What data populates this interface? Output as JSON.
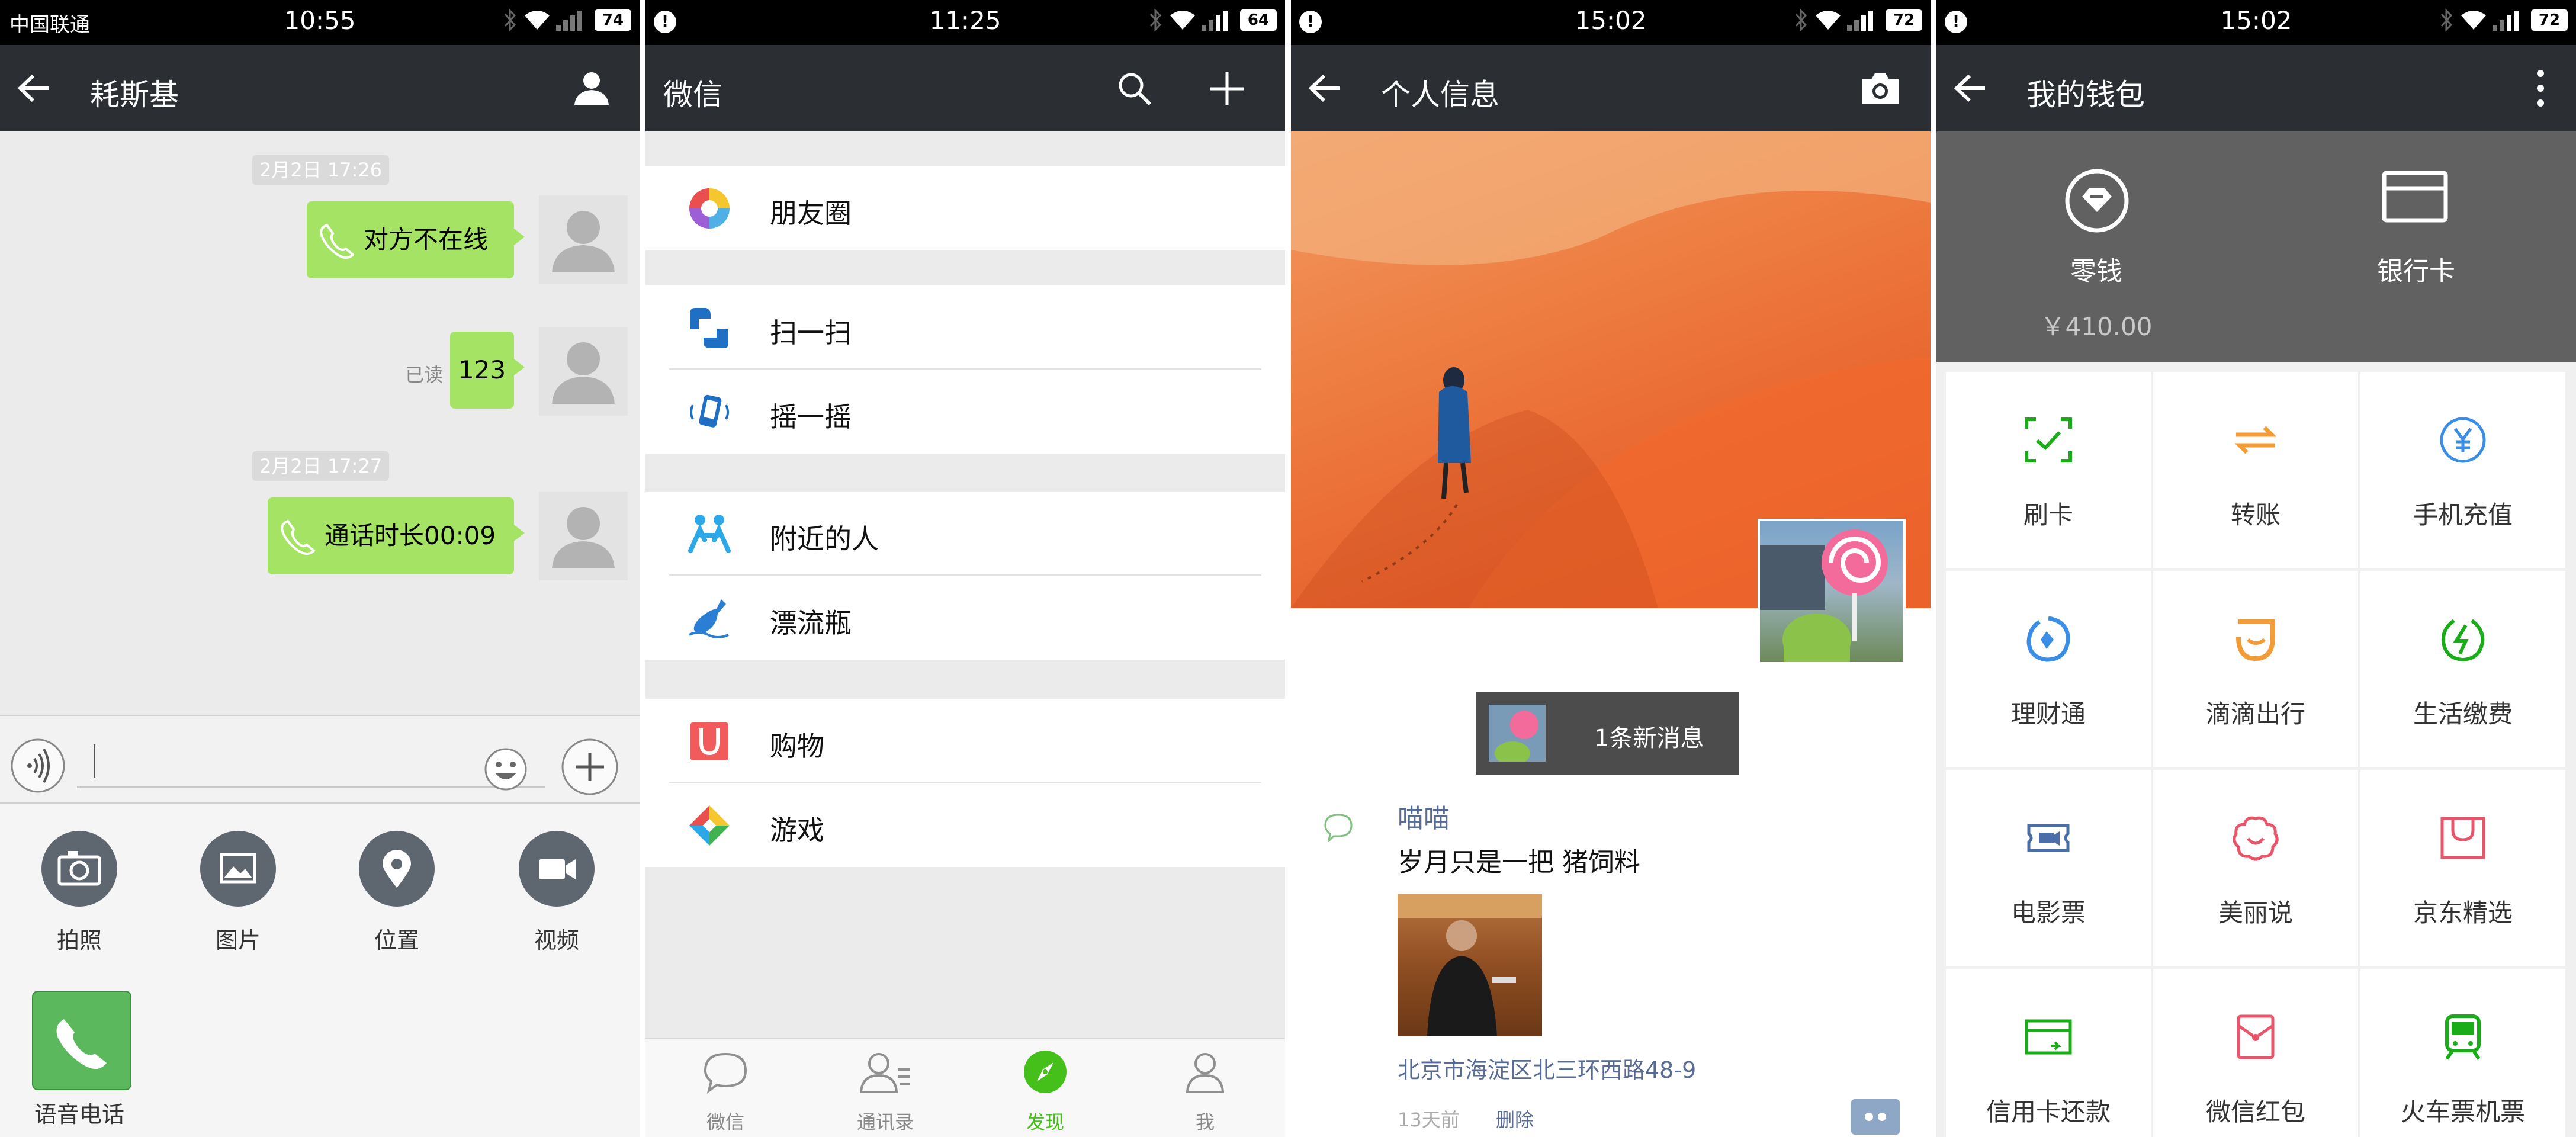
{
  "screen1": {
    "status": {
      "carrier": "中国联通",
      "time": "10:55",
      "battery": "74"
    },
    "title": "耗斯基",
    "messages": [
      {
        "time": "2月2日 17:26"
      },
      {
        "text": "对方不在线"
      },
      {
        "read": "已读",
        "text": "123"
      },
      {
        "time": "2月2日 17:27"
      },
      {
        "text": "通话时长00:09"
      }
    ],
    "panel": [
      {
        "label": "拍照",
        "icon": "camera-icon"
      },
      {
        "label": "图片",
        "icon": "image-icon"
      },
      {
        "label": "位置",
        "icon": "location-icon"
      },
      {
        "label": "视频",
        "icon": "video-icon"
      },
      {
        "label": "语音电话",
        "icon": "phone-icon"
      }
    ]
  },
  "screen2": {
    "status": {
      "time": "11:25",
      "battery": "64"
    },
    "title": "微信",
    "items": [
      {
        "label": "朋友圈",
        "icon": "moments-icon"
      },
      {
        "label": "扫一扫",
        "icon": "scan-icon"
      },
      {
        "label": "摇一摇",
        "icon": "shake-icon"
      },
      {
        "label": "附近的人",
        "icon": "nearby-icon"
      },
      {
        "label": "漂流瓶",
        "icon": "bottle-icon"
      },
      {
        "label": "购物",
        "icon": "shopping-icon"
      },
      {
        "label": "游戏",
        "icon": "games-icon"
      }
    ],
    "tabs": [
      {
        "label": "微信",
        "icon": "chat-icon"
      },
      {
        "label": "通讯录",
        "icon": "contacts-icon"
      },
      {
        "label": "发现",
        "icon": "discover-icon"
      },
      {
        "label": "我",
        "icon": "me-icon"
      }
    ],
    "active_color": "#45c01a"
  },
  "screen3": {
    "status": {
      "time": "15:02",
      "battery": "72"
    },
    "title": "个人信息",
    "new_message": "1条新消息",
    "post": {
      "name": "喵喵",
      "text": "岁月只是一把 猪饲料",
      "location": "北京市海淀区北三环西路48-9",
      "time": "13天前",
      "delete": "删除"
    }
  },
  "screen4": {
    "status": {
      "time": "15:02",
      "battery": "72"
    },
    "title": "我的钱包",
    "header": [
      {
        "label": "零钱",
        "value": "￥410.00",
        "icon": "coin-icon"
      },
      {
        "label": "银行卡",
        "icon": "bank-card-icon"
      }
    ],
    "grid": [
      {
        "label": "刷卡",
        "icon": "pay-card-icon",
        "color": "#1aad19"
      },
      {
        "label": "转账",
        "icon": "transfer-icon",
        "color": "#f29c38"
      },
      {
        "label": "手机充值",
        "icon": "phone-topup-icon",
        "color": "#3a8ee6"
      },
      {
        "label": "理财通",
        "icon": "wealth-icon",
        "color": "#3a8ee6"
      },
      {
        "label": "滴滴出行",
        "icon": "didi-icon",
        "color": "#f29c38"
      },
      {
        "label": "生活缴费",
        "icon": "utility-icon",
        "color": "#1aad19"
      },
      {
        "label": "电影票",
        "icon": "movie-ticket-icon",
        "color": "#4a6fa8"
      },
      {
        "label": "美丽说",
        "icon": "meilishuo-icon",
        "color": "#e8546a"
      },
      {
        "label": "京东精选",
        "icon": "jd-icon",
        "color": "#e8546a"
      },
      {
        "label": "信用卡还款",
        "icon": "credit-card-icon",
        "color": "#1aad19"
      },
      {
        "label": "微信红包",
        "icon": "red-packet-icon",
        "color": "#e8546a"
      },
      {
        "label": "火车票机票",
        "icon": "train-icon",
        "color": "#1aad19"
      }
    ]
  }
}
